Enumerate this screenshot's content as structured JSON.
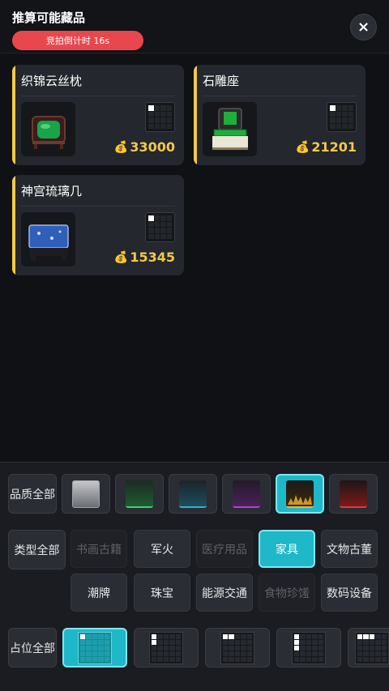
{
  "header": {
    "title": "推算可能藏品",
    "countdown": "竞拍倒计时 16s",
    "close_label": "×"
  },
  "cards": [
    {
      "name": "织锦云丝枕",
      "price": "33000",
      "grid_on": [
        0
      ],
      "jade": "#19a34a"
    },
    {
      "name": "石雕座",
      "price": "21201",
      "grid_on": [
        0
      ],
      "jade": "#1fae3c"
    },
    {
      "name": "神宫琉璃几",
      "price": "15345",
      "grid_on": [
        0
      ],
      "jade": "#2f5fb8"
    }
  ],
  "filters": {
    "quality_label": "品质全部",
    "quality_swatches": [
      {
        "name": "white",
        "color": "#8a8d92",
        "selected": false
      },
      {
        "name": "green",
        "color": "#1f5b31",
        "selected": false
      },
      {
        "name": "blue",
        "color": "#1e4d5c",
        "selected": false
      },
      {
        "name": "purple",
        "color": "#4a2157",
        "selected": false
      },
      {
        "name": "gold",
        "color": "#a66d11",
        "selected": true
      },
      {
        "name": "red",
        "color": "#7a1a1a",
        "selected": false
      }
    ],
    "type_label": "类型全部",
    "types": [
      {
        "label": "书画古籍",
        "state": "disabled"
      },
      {
        "label": "军火",
        "state": "normal"
      },
      {
        "label": "医疗用品",
        "state": "disabled"
      },
      {
        "label": "家具",
        "state": "selected"
      },
      {
        "label": "文物古董",
        "state": "normal"
      },
      {
        "label": "潮牌",
        "state": "normal"
      },
      {
        "label": "珠宝",
        "state": "normal"
      },
      {
        "label": "能源交通",
        "state": "normal"
      },
      {
        "label": "食物珍馐",
        "state": "disabled"
      },
      {
        "label": "数码设备",
        "state": "normal"
      }
    ],
    "slot_label": "占位全部"
  },
  "colors": {
    "accent": "#1fb8c9",
    "price": "#f2c94c",
    "countdown_bg": "#e8474d"
  }
}
